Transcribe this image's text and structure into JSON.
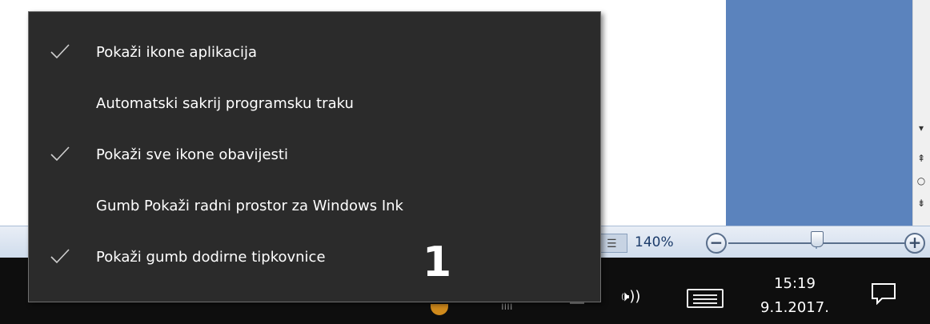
{
  "context_menu": {
    "items": [
      {
        "label": "Pokaži ikone aplikacija",
        "checked": true
      },
      {
        "label": "Automatski sakrij programsku traku",
        "checked": false
      },
      {
        "label": "Pokaži sve ikone obavijesti",
        "checked": true
      },
      {
        "label": "Gumb Pokaži radni prostor za Windows Ink",
        "checked": false
      },
      {
        "label": "Pokaži gumb dodirne tipkovnice",
        "checked": true
      }
    ],
    "annotation_number": "1",
    "background": "#2b2b2b",
    "text_color": "#ffffff"
  },
  "statusbar": {
    "zoom_percent": "140%",
    "zoom_minus_symbol": "−",
    "zoom_plus_symbol": "+"
  },
  "taskbar": {
    "time": "15:19",
    "date": "9.1.2017.",
    "volume_icon": "speaker-icon",
    "keyboard_icon": "touch-keyboard-icon",
    "action_center_icon": "notification-icon",
    "background": "#0e0e0e"
  },
  "colors": {
    "word_blue": "#5b83bd"
  }
}
